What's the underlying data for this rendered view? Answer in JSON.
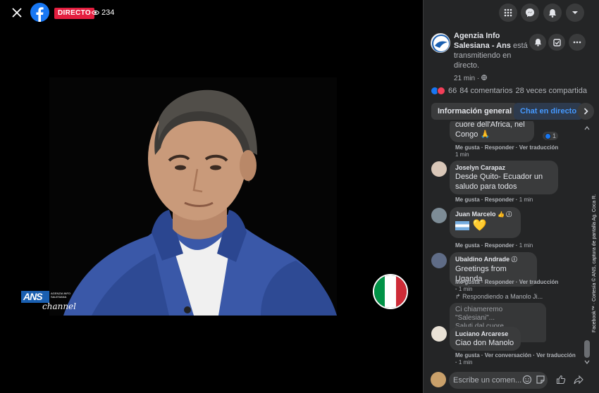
{
  "video": {
    "live_label": "DIRECTO",
    "viewer_count": "234",
    "logo_main": "ANS",
    "logo_small": "AGENZIA INFO SALESIANA",
    "logo_channel": "channel",
    "flag_colors": [
      "#009246",
      "#ffffff",
      "#ce2b37"
    ]
  },
  "page": {
    "name": "Agenzia Info Salesiana - Ans",
    "status_text": " está transmitiendo en directo.",
    "time": "21 min"
  },
  "stats": {
    "reactions_count": "66",
    "comments": "84 comentarios",
    "shares": "28 veces compartida"
  },
  "tabs": {
    "info": "Información general",
    "chat": "Chat en directo"
  },
  "comments": [
    {
      "text": "cuore dell'Africa, nel Congo 🙏",
      "reaction_count": "1",
      "actions": [
        "Me gusta",
        "Responder",
        "Ver traducción"
      ],
      "time": "1 min"
    },
    {
      "name": "Joselyn Carapaz",
      "text": "Desde Quito- Ecuador un saludo para todos",
      "actions": [
        "Me gusta",
        "Responder"
      ],
      "time": "1 min"
    },
    {
      "name": "Juan Marcelo",
      "text": "💛",
      "actions": [
        "Me gusta",
        "Responder"
      ],
      "time": "1 min"
    },
    {
      "name": "Ubaldino Andrade",
      "text": "Greetings from Uganda",
      "actions": [
        "Me gusta",
        "Responder",
        "Ver traducción"
      ],
      "time": "1 min"
    },
    {
      "reply_to": "Respondiendo a Manolo Ji...",
      "quote_line1": "Ci chiameremo \"Salesiani\"...",
      "quote_line2": "Saluti dal cuore dell'Africa,...",
      "name": "Luciano Arcarese",
      "text": "Ciao don Manolo",
      "actions": [
        "Me gusta",
        "Ver conversación",
        "Ver traducción"
      ],
      "time": "1 min"
    }
  ],
  "composer": {
    "placeholder": "Escribe un comen..."
  },
  "credit": "Facebook™ · Cortesía © ANS, captura de pantalla Ag. Coca R.",
  "colors": {
    "accent": "#1877f2",
    "live_red": "#e41e3f",
    "panel_bg": "#242526"
  }
}
